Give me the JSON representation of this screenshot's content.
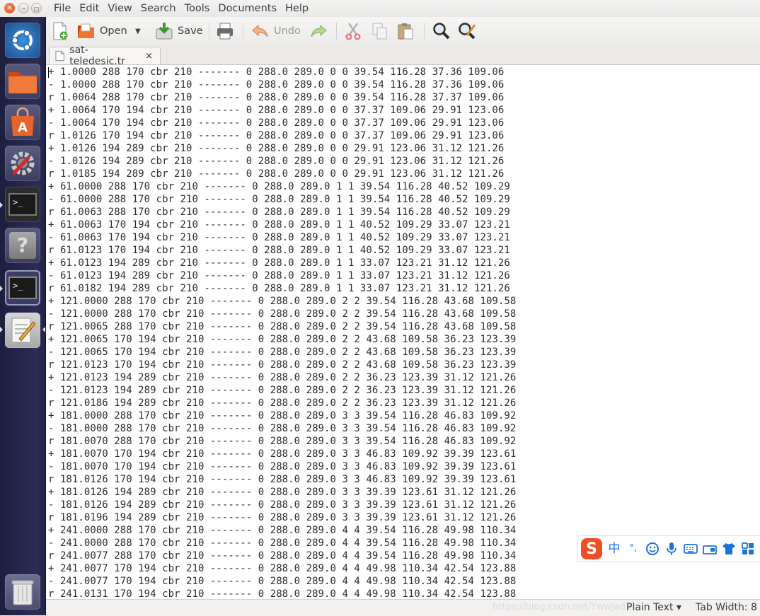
{
  "window": {
    "close_glyph": "×",
    "min_glyph": "–",
    "max_glyph": "□"
  },
  "menubar": [
    "File",
    "Edit",
    "View",
    "Search",
    "Tools",
    "Documents",
    "Help"
  ],
  "toolbar": {
    "open_label": "Open",
    "save_label": "Save",
    "undo_label": "Undo"
  },
  "tab": {
    "title": "sat-teledesic.tr",
    "close": "×"
  },
  "editor": {
    "lines": [
      "+ 1.0000 288 170 cbr 210 ------- 0 288.0 289.0 0 0 39.54 116.28 37.36 109.06",
      "- 1.0000 288 170 cbr 210 ------- 0 288.0 289.0 0 0 39.54 116.28 37.36 109.06",
      "r 1.0064 288 170 cbr 210 ------- 0 288.0 289.0 0 0 39.54 116.28 37.37 109.06",
      "+ 1.0064 170 194 cbr 210 ------- 0 288.0 289.0 0 0 37.37 109.06 29.91 123.06",
      "- 1.0064 170 194 cbr 210 ------- 0 288.0 289.0 0 0 37.37 109.06 29.91 123.06",
      "r 1.0126 170 194 cbr 210 ------- 0 288.0 289.0 0 0 37.37 109.06 29.91 123.06",
      "+ 1.0126 194 289 cbr 210 ------- 0 288.0 289.0 0 0 29.91 123.06 31.12 121.26",
      "- 1.0126 194 289 cbr 210 ------- 0 288.0 289.0 0 0 29.91 123.06 31.12 121.26",
      "r 1.0185 194 289 cbr 210 ------- 0 288.0 289.0 0 0 29.91 123.06 31.12 121.26",
      "+ 61.0000 288 170 cbr 210 ------- 0 288.0 289.0 1 1 39.54 116.28 40.52 109.29",
      "- 61.0000 288 170 cbr 210 ------- 0 288.0 289.0 1 1 39.54 116.28 40.52 109.29",
      "r 61.0063 288 170 cbr 210 ------- 0 288.0 289.0 1 1 39.54 116.28 40.52 109.29",
      "+ 61.0063 170 194 cbr 210 ------- 0 288.0 289.0 1 1 40.52 109.29 33.07 123.21",
      "- 61.0063 170 194 cbr 210 ------- 0 288.0 289.0 1 1 40.52 109.29 33.07 123.21",
      "r 61.0123 170 194 cbr 210 ------- 0 288.0 289.0 1 1 40.52 109.29 33.07 123.21",
      "+ 61.0123 194 289 cbr 210 ------- 0 288.0 289.0 1 1 33.07 123.21 31.12 121.26",
      "- 61.0123 194 289 cbr 210 ------- 0 288.0 289.0 1 1 33.07 123.21 31.12 121.26",
      "r 61.0182 194 289 cbr 210 ------- 0 288.0 289.0 1 1 33.07 123.21 31.12 121.26",
      "+ 121.0000 288 170 cbr 210 ------- 0 288.0 289.0 2 2 39.54 116.28 43.68 109.58",
      "- 121.0000 288 170 cbr 210 ------- 0 288.0 289.0 2 2 39.54 116.28 43.68 109.58",
      "r 121.0065 288 170 cbr 210 ------- 0 288.0 289.0 2 2 39.54 116.28 43.68 109.58",
      "+ 121.0065 170 194 cbr 210 ------- 0 288.0 289.0 2 2 43.68 109.58 36.23 123.39",
      "- 121.0065 170 194 cbr 210 ------- 0 288.0 289.0 2 2 43.68 109.58 36.23 123.39",
      "r 121.0123 170 194 cbr 210 ------- 0 288.0 289.0 2 2 43.68 109.58 36.23 123.39",
      "+ 121.0123 194 289 cbr 210 ------- 0 288.0 289.0 2 2 36.23 123.39 31.12 121.26",
      "- 121.0123 194 289 cbr 210 ------- 0 288.0 289.0 2 2 36.23 123.39 31.12 121.26",
      "r 121.0186 194 289 cbr 210 ------- 0 288.0 289.0 2 2 36.23 123.39 31.12 121.26",
      "+ 181.0000 288 170 cbr 210 ------- 0 288.0 289.0 3 3 39.54 116.28 46.83 109.92",
      "- 181.0000 288 170 cbr 210 ------- 0 288.0 289.0 3 3 39.54 116.28 46.83 109.92",
      "r 181.0070 288 170 cbr 210 ------- 0 288.0 289.0 3 3 39.54 116.28 46.83 109.92",
      "+ 181.0070 170 194 cbr 210 ------- 0 288.0 289.0 3 3 46.83 109.92 39.39 123.61",
      "- 181.0070 170 194 cbr 210 ------- 0 288.0 289.0 3 3 46.83 109.92 39.39 123.61",
      "r 181.0126 170 194 cbr 210 ------- 0 288.0 289.0 3 3 46.83 109.92 39.39 123.61",
      "+ 181.0126 194 289 cbr 210 ------- 0 288.0 289.0 3 3 39.39 123.61 31.12 121.26",
      "- 181.0126 194 289 cbr 210 ------- 0 288.0 289.0 3 3 39.39 123.61 31.12 121.26",
      "r 181.0196 194 289 cbr 210 ------- 0 288.0 289.0 3 3 39.39 123.61 31.12 121.26",
      "+ 241.0000 288 170 cbr 210 ------- 0 288.0 289.0 4 4 39.54 116.28 49.98 110.34",
      "- 241.0000 288 170 cbr 210 ------- 0 288.0 289.0 4 4 39.54 116.28 49.98 110.34",
      "r 241.0077 288 170 cbr 210 ------- 0 288.0 289.0 4 4 39.54 116.28 49.98 110.34",
      "+ 241.0077 170 194 cbr 210 ------- 0 288.0 289.0 4 4 49.98 110.34 42.54 123.88",
      "- 241.0077 170 194 cbr 210 ------- 0 288.0 289.0 4 4 49.98 110.34 42.54 123.88",
      "r 241.0131 170 194 cbr 210 ------- 0 288.0 289.0 4 4 49.98 110.34 42.54 123.88"
    ]
  },
  "statusbar": {
    "watermark": "https://blog.csdn.net/Ywwjad",
    "language": "Plain Text ▾",
    "tab_width": "Tab Width: 8"
  },
  "ime": {
    "chinese_mode": "中",
    "punct": "°,"
  },
  "colors": {
    "launcher": "#2b2d55",
    "ubuntu_orange": "#dd4814",
    "ime_blue": "#1b73d6"
  }
}
